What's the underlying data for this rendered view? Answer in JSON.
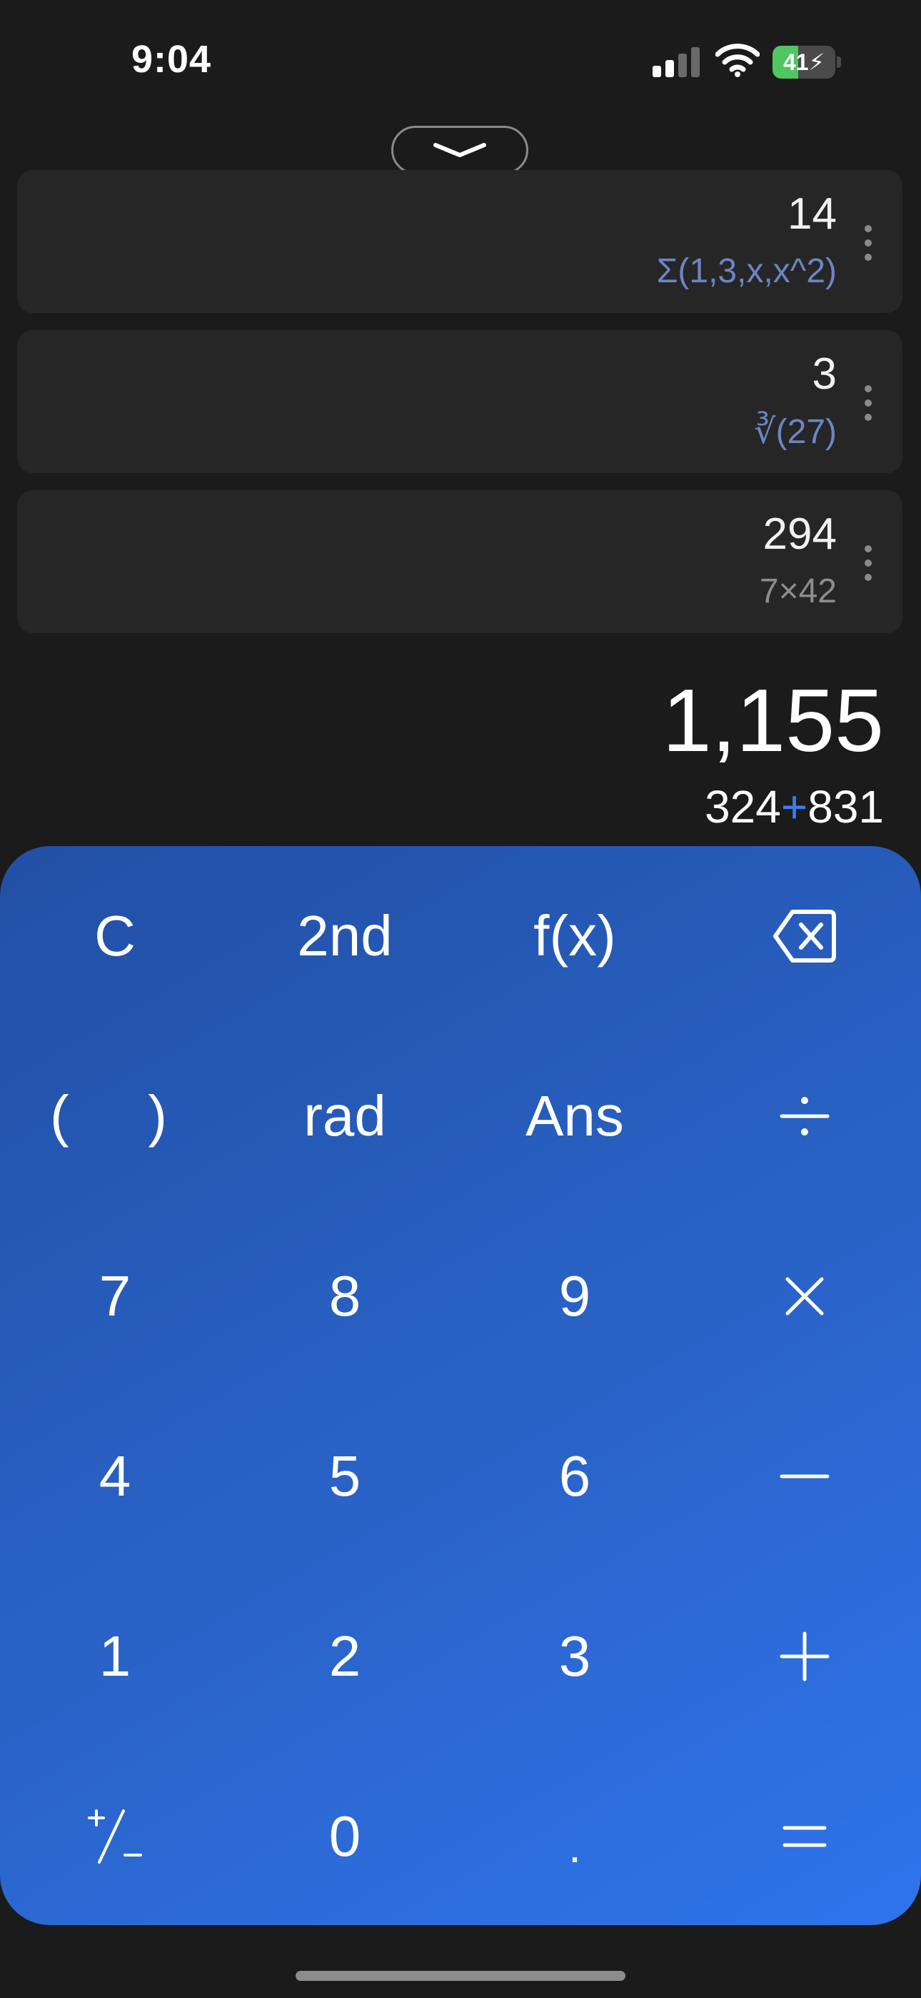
{
  "status_bar": {
    "time": "9:04",
    "battery_percent": "41",
    "battery_level": 0.41,
    "battery_color": "#4fc660"
  },
  "history": [
    {
      "result": "14",
      "expression_prefix": "Σ",
      "expression": "(1,3,x,x^2)"
    },
    {
      "result": "3",
      "expression_prefix": "∛",
      "expression": "(27)"
    },
    {
      "result": "294",
      "expression_prefix": "",
      "expression": "7×42"
    }
  ],
  "current": {
    "result": "1,155",
    "operand_a": "324",
    "operator": "+",
    "operand_b": "831"
  },
  "keypad": {
    "clear": "C",
    "second": "2nd",
    "function": "f(x)",
    "open_paren": "(",
    "close_paren": ")",
    "rad": "rad",
    "ans": "Ans",
    "digits": [
      "0",
      "1",
      "2",
      "3",
      "4",
      "5",
      "6",
      "7",
      "8",
      "9"
    ],
    "decimal": ".",
    "icons": {
      "backspace": "backspace-icon",
      "divide": "divide-icon",
      "multiply": "multiply-icon",
      "subtract": "minus-icon",
      "add": "plus-icon",
      "equals": "equals-icon",
      "plus_minus": "plus-minus-icon"
    }
  },
  "colors": {
    "background": "#1b1b1b",
    "card": "#262626",
    "accent": "#3e7bef",
    "expression_blue": "#6b86c4",
    "keypad_start": "#2150a5",
    "keypad_end": "#2f74ec"
  }
}
